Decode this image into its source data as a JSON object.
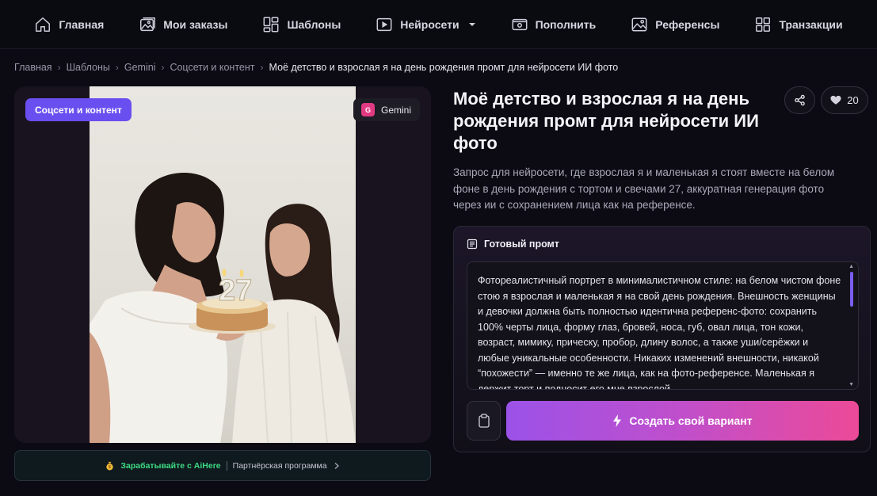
{
  "nav": {
    "items": [
      {
        "label": "Главная",
        "icon": "home-icon"
      },
      {
        "label": "Мои заказы",
        "icon": "image-gallery-icon"
      },
      {
        "label": "Шаблоны",
        "icon": "templates-grid-icon"
      },
      {
        "label": "Нейросети",
        "icon": "play-window-icon"
      },
      {
        "label": "Пополнить",
        "icon": "wallet-icon"
      },
      {
        "label": "Референсы",
        "icon": "picture-icon"
      },
      {
        "label": "Транзакции",
        "icon": "grid-icon"
      }
    ]
  },
  "breadcrumb": {
    "items": [
      "Главная",
      "Шаблоны",
      "Gemini",
      "Соцсети и контент"
    ],
    "current": "Моё детство и взрослая я на день рождения промт для нейросети ИИ фото",
    "separator": "›"
  },
  "image_card": {
    "category_badge": "Соцсети и контент",
    "model_badge": "Gemini",
    "model_icon_letter": "G",
    "cake_number": "27",
    "accent_color": "#6a4ff0"
  },
  "affiliate": {
    "earn_label": "Зарабатывайте с AiHere",
    "program_label": "Партнёрская программа"
  },
  "detail": {
    "title": "Моё детство и взрослая я на день рождения промт для нейросети ИИ фото",
    "description": "Запрос для нейросети, где взрослая я и маленькая я стоят вместе на белом фоне в день рождения с тортом и свечами 27, аккуратная генерация фото через ии с сохранением лица как на референсе.",
    "likes": "20"
  },
  "prompt": {
    "header": "Готовый промт",
    "text": "Фотореалистичный портрет в минималистичном стиле: на белом чистом фоне стою я взрослая и маленькая я на свой день рождения. Внешность женщины и девочки должна быть полностью идентична референс-фото: сохранить 100% черты лица, форму глаз, бровей, носа, губ, овал лица, тон кожи, возраст, мимику, прическу, пробор, длину волос, а также уши/серёжки и любые уникальные особенности. Никаких изменений внешности, никакой “похожести” — именно те же лица, как на фото-референсе. Маленькая я держит торт и подносит его мне взрослой",
    "create_button": "Создать свой вариант",
    "button_gradient": [
      "#9b52e8",
      "#ec4a97"
    ]
  }
}
